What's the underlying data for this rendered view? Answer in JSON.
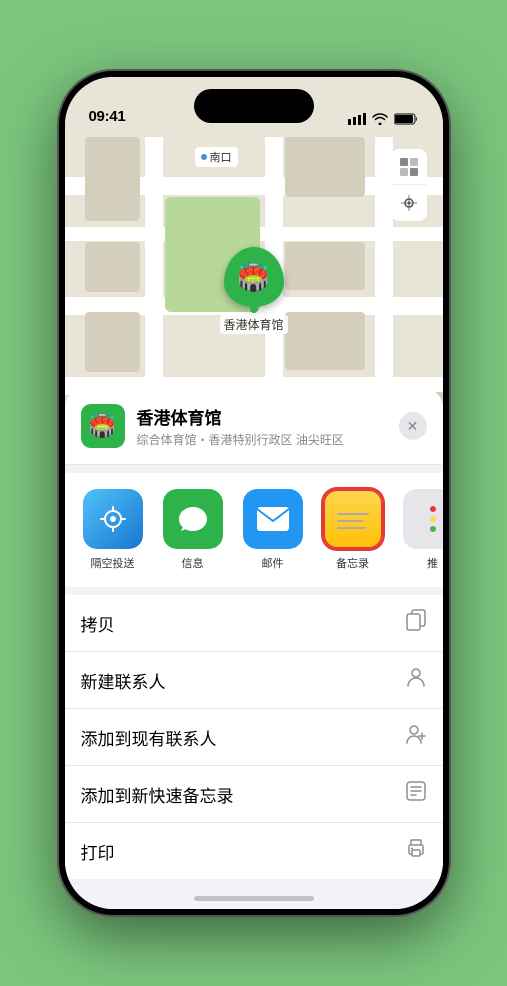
{
  "status_bar": {
    "time": "09:41",
    "location_arrow": "▶",
    "signal": "●●●",
    "wifi": "wifi",
    "battery": "battery"
  },
  "map": {
    "label_text": "南口",
    "controls": [
      "map-icon",
      "location-icon"
    ]
  },
  "venue": {
    "name": "香港体育馆",
    "subtitle": "综合体育馆・香港特别行政区 油尖旺区",
    "icon_emoji": "🏟️"
  },
  "share_items": [
    {
      "id": "airdrop",
      "label": "隔空投送",
      "type": "airdrop"
    },
    {
      "id": "messages",
      "label": "信息",
      "type": "messages"
    },
    {
      "id": "mail",
      "label": "邮件",
      "type": "mail"
    },
    {
      "id": "notes",
      "label": "备忘录",
      "type": "notes"
    },
    {
      "id": "more",
      "label": "推",
      "type": "more"
    }
  ],
  "actions": [
    {
      "id": "copy",
      "label": "拷贝",
      "icon": "copy"
    },
    {
      "id": "add-contact",
      "label": "新建联系人",
      "icon": "person"
    },
    {
      "id": "add-existing-contact",
      "label": "添加到现有联系人",
      "icon": "person-add"
    },
    {
      "id": "add-quick-note",
      "label": "添加到新快速备忘录",
      "icon": "note"
    },
    {
      "id": "print",
      "label": "打印",
      "icon": "print"
    }
  ],
  "close_button_label": "✕"
}
